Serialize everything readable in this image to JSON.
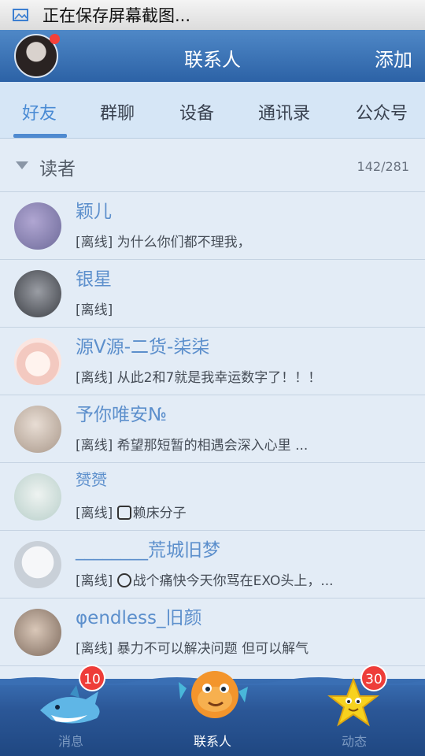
{
  "statusbar": {
    "text": "正在保存屏幕截图..."
  },
  "header": {
    "title": "联系人",
    "add": "添加"
  },
  "tabs": [
    "好友",
    "群聊",
    "设备",
    "通讯录",
    "公众号"
  ],
  "group": {
    "name": "读者",
    "count": "142/281"
  },
  "contacts": [
    {
      "name": "颖儿",
      "prefix": "[离线]",
      "message": "为什么你们都不理我，",
      "avatar_color": "#8b86b3"
    },
    {
      "name": "银星",
      "prefix": "[离线]",
      "message": "",
      "avatar_color": "#5c5f66"
    },
    {
      "name": "源V源-二货-柒柒",
      "prefix": "[离线]",
      "message": "从此2和7就是我幸运数字了！！！",
      "avatar_color": "#f4d7d1"
    },
    {
      "name": "予你唯安№",
      "prefix": "[离线]",
      "message": "希望那短暂的相遇会深入心里  ...",
      "avatar_color": "#c9b7a6"
    },
    {
      "name": "赟赟",
      "prefix": "[离线]",
      "message": "赖床分子",
      "avatar_color": "#c6d9d6"
    },
    {
      "name": "________荒城旧梦",
      "prefix": "[离线]",
      "message": "战个痛快今天你骂在EXO头上，...",
      "avatar_color": "#d8dde3"
    },
    {
      "name": "φendless_旧颜",
      "prefix": "[离线]",
      "message": "暴力不可以解决问题  但可以解气",
      "avatar_color": "#a38c7d"
    }
  ],
  "bottom_nav": [
    {
      "label": "消息",
      "badge": "10",
      "icon": "shark-icon"
    },
    {
      "label": "联系人",
      "badge": "",
      "icon": "fish-icon"
    },
    {
      "label": "动态",
      "badge": "30",
      "icon": "star-icon"
    }
  ]
}
